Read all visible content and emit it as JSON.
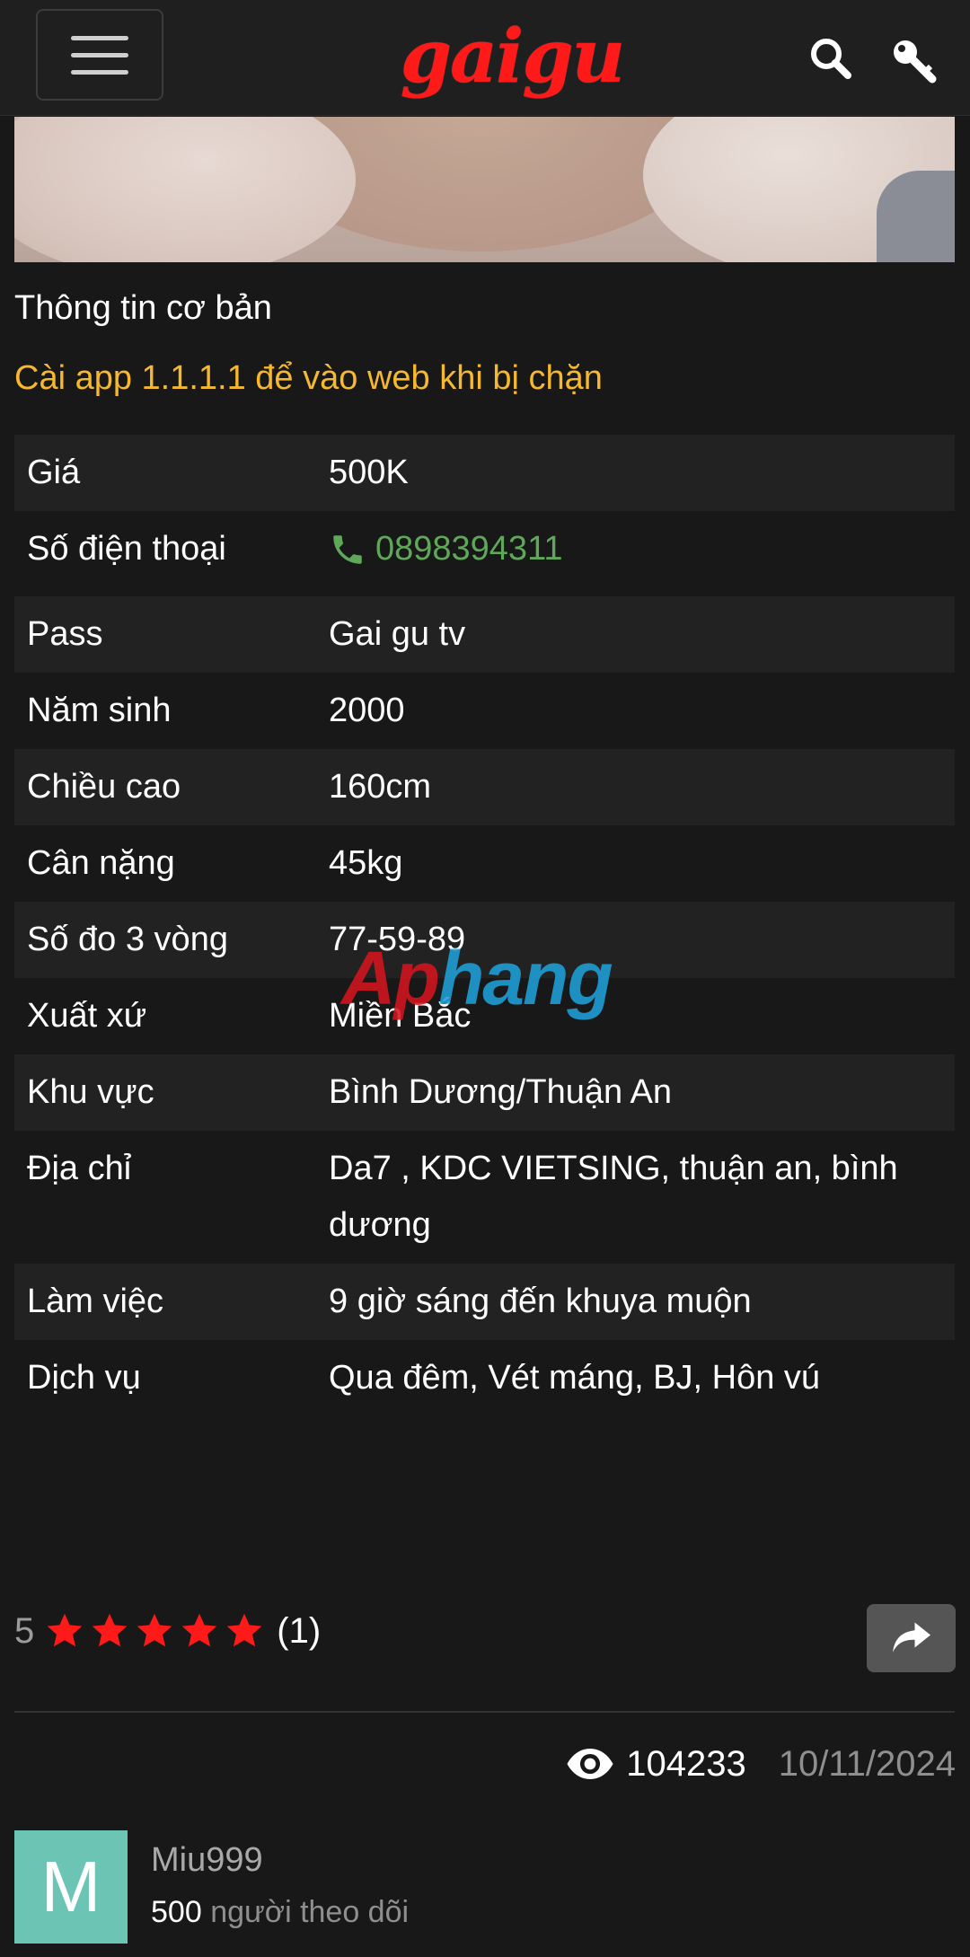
{
  "header": {
    "logo_text": "gaigu",
    "menu_icon": "hamburger-icon",
    "search_icon": "search-icon",
    "login_icon": "key-icon"
  },
  "content": {
    "section_title": "Thông tin cơ bản",
    "notice": "Cài app 1.1.1.1 để vào web khi bị chặn"
  },
  "info": {
    "rows": [
      {
        "label": "Giá",
        "value": "500K"
      },
      {
        "label": "Số điện thoại",
        "value": "0898394311"
      },
      {
        "label": "Pass",
        "value": "Gai gu tv"
      },
      {
        "label": "Năm sinh",
        "value": "2000"
      },
      {
        "label": "Chiều cao",
        "value": "160cm"
      },
      {
        "label": "Cân nặng",
        "value": "45kg"
      },
      {
        "label": "Số đo 3 vòng",
        "value": "77-59-89"
      },
      {
        "label": "Xuất xứ",
        "value": "Miền Bắc"
      },
      {
        "label": "Khu vực",
        "value": "Bình Dương/Thuận An"
      },
      {
        "label": "Địa chỉ",
        "value": "Da7 , KDC VIETSING, thuận an, bình dương"
      },
      {
        "label": "Làm việc",
        "value": "9 giờ sáng đến khuya muộn"
      },
      {
        "label": "Dịch vụ",
        "value": "Qua đêm, Vét máng, BJ, Hôn vú"
      }
    ]
  },
  "watermark": {
    "part1": "Ap",
    "part2": "hang"
  },
  "rating": {
    "score": "5",
    "stars": 5,
    "count": "(1)"
  },
  "stats": {
    "views": "104233",
    "date": "10/11/2024"
  },
  "author": {
    "initial": "M",
    "name": "Miu999",
    "followers_count": "500",
    "followers_label": "người theo dõi"
  },
  "colors": {
    "accent": "#f5b82e",
    "phone": "#5fa85a",
    "star": "#ff1a1a",
    "logo": "#ff1a1a",
    "avatar": "#6cc4b5"
  }
}
